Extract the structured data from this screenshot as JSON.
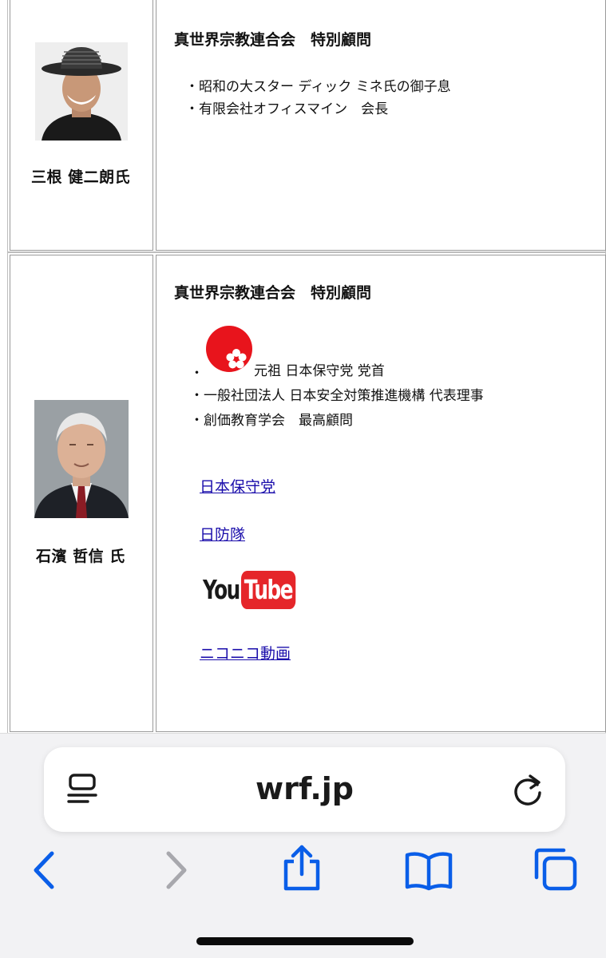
{
  "browser": {
    "url": "wrf.jp",
    "reader_icon": "reader-mode-icon",
    "reload_icon": "reload-icon",
    "toolbar_icons": [
      "back-icon",
      "forward-icon",
      "share-icon",
      "bookmarks-icon",
      "tabs-icon"
    ],
    "accent_color": "#0a5ee8",
    "disabled_color": "#a8a8ad"
  },
  "persons": [
    {
      "name": "三根 健二朗氏",
      "heading": "真世界宗教連合会　特別顧問",
      "items": [
        "・昭和の大スター ディック ミネ氏の御子息",
        "・有限会社オフィスマイン　会長"
      ]
    },
    {
      "name": "石濱 哲信 氏",
      "heading": "真世界宗教連合会　特別顧問",
      "items": [
        "元祖 日本保守党 党首",
        "・一般社団法人 日本安全対策推進機構 代表理事",
        "・創価教育学会　最高顧問"
      ],
      "bullet": "・",
      "links": [
        "日本保守党",
        "日防隊",
        "ニコニコ動画"
      ],
      "youtube_logo": {
        "you": "You",
        "tube": "Tube",
        "color": "#e5262a"
      }
    }
  ]
}
